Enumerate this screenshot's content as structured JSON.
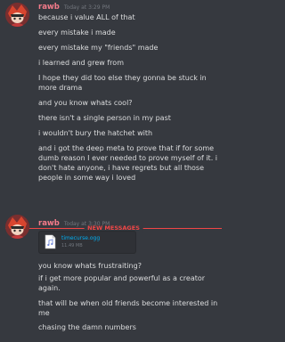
{
  "divider": {
    "label": "NEW MESSAGES"
  },
  "group1": {
    "username": "rawb",
    "timestamp": "Today at 3:29 PM",
    "avatar": "avatar-image",
    "lines": [
      "because i value ALL of that",
      "every mistake i made",
      "every mistake my \"friends\" made",
      "i learned and grew from",
      "I hope they did too else they gonna be stuck in more drama",
      "and you know whats cool?",
      "there isn't a single person in my past",
      "i wouldn't bury the hatchet with",
      "and i got the deep meta to prove that if for some dumb reason I ever needed to prove myself of it. i don't hate anyone, i have regrets but all those people in some way i loved"
    ]
  },
  "group2": {
    "username": "rawb",
    "timestamp": "Today at 3:30 PM",
    "avatar": "avatar-image",
    "attachment": {
      "name": "timecurse.ogg",
      "size": "11.49 MB",
      "icon": "audio-file-icon"
    },
    "lines": [
      "you know whats frustraiting?",
      "if i get more popular and powerful as a creator again.",
      "that will be when old friends become interested in me",
      "chasing the damn numbers"
    ]
  },
  "colors": {
    "background": "#36393f",
    "username": "#f47b8a",
    "new_messages": "#f04747",
    "link": "#00b0f4"
  }
}
